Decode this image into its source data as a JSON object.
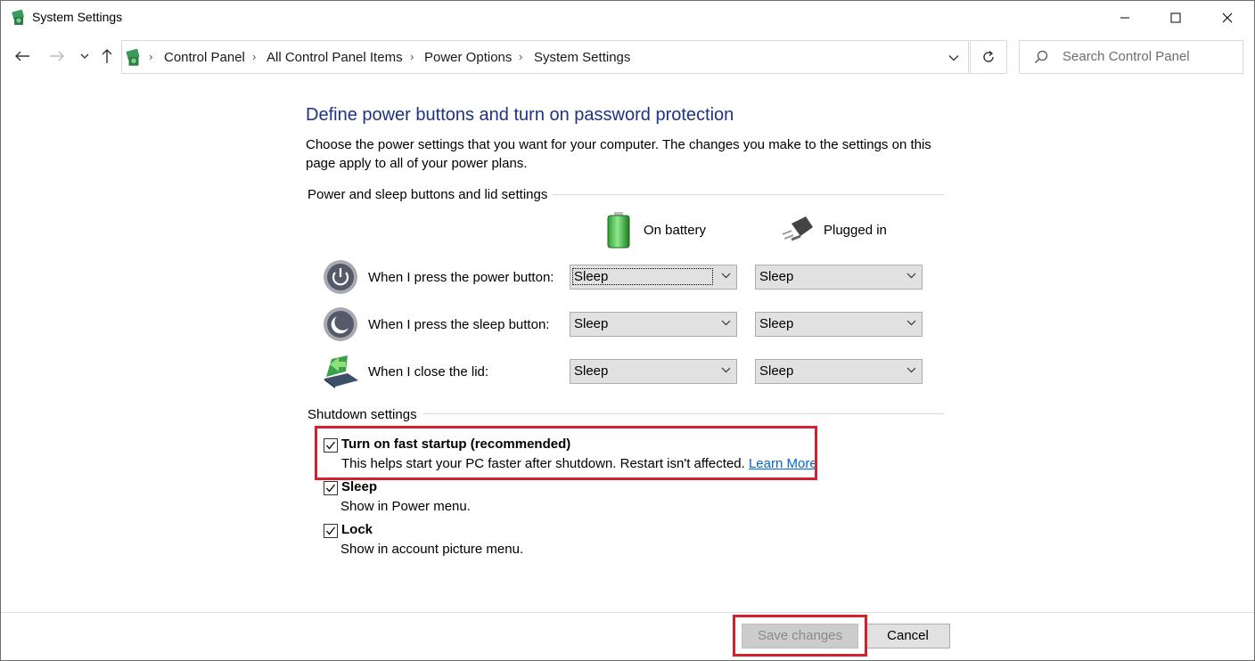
{
  "window": {
    "title": "System Settings"
  },
  "nav": {
    "breadcrumb": [
      "Control Panel",
      "All Control Panel Items",
      "Power Options",
      "System Settings"
    ],
    "search_placeholder": "Search Control Panel"
  },
  "page": {
    "heading": "Define power buttons and turn on password protection",
    "description": "Choose the power settings that you want for your computer. The changes you make to the settings on this page apply to all of your power plans."
  },
  "power_buttons": {
    "group_label": "Power and sleep buttons and lid settings",
    "col_battery": "On battery",
    "col_plugged": "Plugged in",
    "rows": [
      {
        "label": "When I press the power button:",
        "battery": "Sleep",
        "plugged": "Sleep",
        "icon": "power-button-icon"
      },
      {
        "label": "When I press the sleep button:",
        "battery": "Sleep",
        "plugged": "Sleep",
        "icon": "sleep-button-icon"
      },
      {
        "label": "When I close the lid:",
        "battery": "Sleep",
        "plugged": "Sleep",
        "icon": "laptop-lid-icon"
      }
    ]
  },
  "shutdown": {
    "group_label": "Shutdown settings",
    "options": [
      {
        "title": "Turn on fast startup (recommended)",
        "desc": "This helps start your PC faster after shutdown. Restart isn't affected.",
        "link": "Learn More",
        "checked": true
      },
      {
        "title": "Sleep",
        "desc": "Show in Power menu.",
        "checked": true
      },
      {
        "title": "Lock",
        "desc": "Show in account picture menu.",
        "checked": true
      }
    ]
  },
  "buttons": {
    "save": "Save changes",
    "cancel": "Cancel"
  },
  "colors": {
    "heading": "#1e3287",
    "highlight_box": "#d3212d",
    "link": "#0066cc"
  }
}
